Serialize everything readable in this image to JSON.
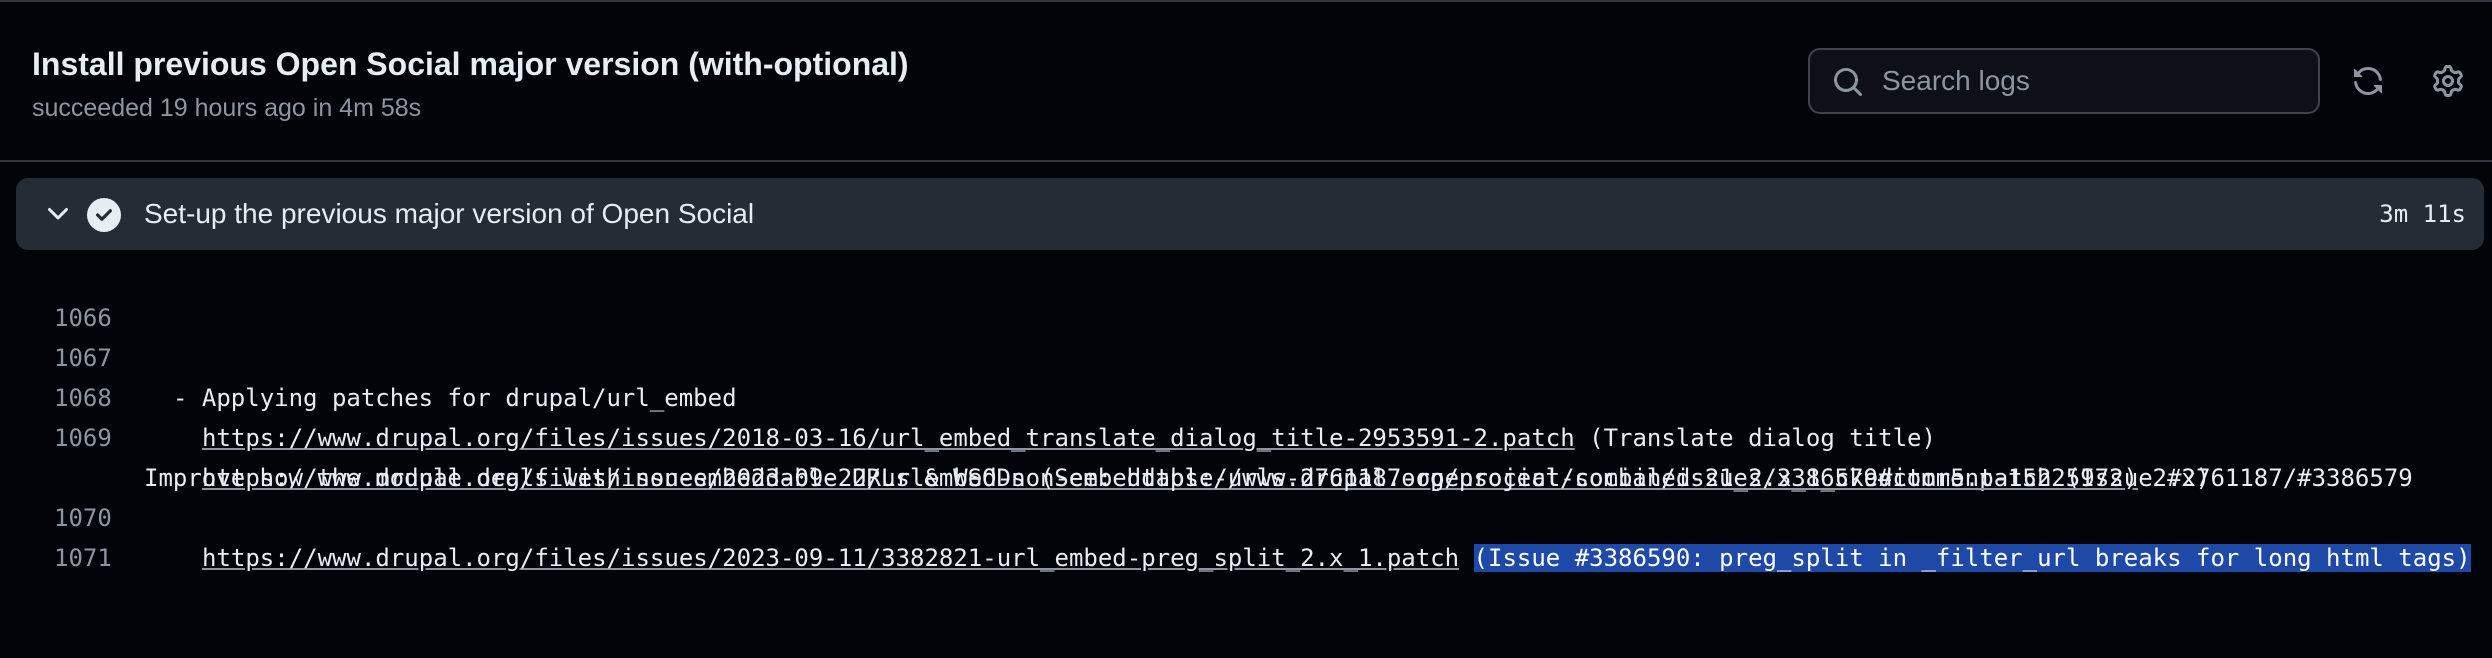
{
  "header": {
    "title": "Install previous Open Social major version (with-optional)",
    "subtitle": "succeeded 19 hours ago in 4m 58s",
    "search_placeholder": "Search logs",
    "icons": [
      "search-icon",
      "refresh-icon",
      "gear-icon"
    ]
  },
  "step": {
    "title": "Set-up the previous major version of Open Social",
    "duration": "3m 11s",
    "status": "success",
    "icons": [
      "chevron-down-icon",
      "check-circle-icon"
    ]
  },
  "log": {
    "lines": [
      {
        "num": "1066",
        "text": ""
      },
      {
        "num": "1067",
        "text": "- Applying patches for drupal/url_embed"
      },
      {
        "num": "1068",
        "link": "https://www.drupal.org/files/issues/2018-03-16/url_embed_translate_dialog_title-2953591-2.patch",
        "suffix": " (Translate dialog title)"
      },
      {
        "num": "1069",
        "link": "https://www.drupal.org/files/issues/2023-09-22/urlembed-non-embeddable-urls-2761187-opensocial-combined-21_2.x_1_ckeditor5.patch",
        "suffix": " (Issue #2761187/#3386579",
        "wrap_prefix": "Improve how the module deals with non-embeddable URLs & WSODs (See: ",
        "wrap_link": "https://www.drupal.org/project/social/issues/3386579#comment-15225972)",
        "wrap_suffix": " 2.x)"
      },
      {
        "num": "1070",
        "link": "https://www.drupal.org/files/issues/2023-09-11/3382821-url_embed-preg_split_2.x_1.patch",
        "suffix": " ",
        "highlight": "(Issue #3386590: preg_split in _filter_url breaks for long html tags)"
      },
      {
        "num": "1071",
        "text": ""
      }
    ]
  },
  "colors": {
    "background": "#010409",
    "step_bar": "#262c36",
    "text": "#e6edf3",
    "muted": "#8d96a0",
    "highlight": "#1f49a6",
    "border": "#30363d"
  }
}
